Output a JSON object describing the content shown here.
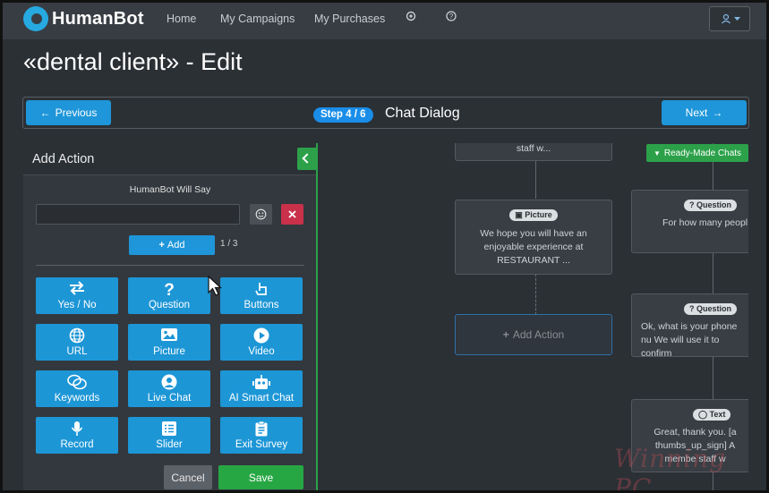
{
  "navbar": {
    "logo_text": "HumanBot",
    "links": [
      "Home",
      "My Campaigns",
      "My Purchases"
    ],
    "icon_1": "settings-icon",
    "icon_2": "help-icon",
    "user_icon": "user-icon",
    "brand_color": "#26a9e0"
  },
  "page": {
    "title": "«dental client» - Edit"
  },
  "stepbar": {
    "previous_label": "Previous",
    "next_label": "Next",
    "step_badge": "Step 4 / 6",
    "step_title": "Chat Dialog"
  },
  "panel": {
    "title": "Add Action",
    "says_label": "HumanBot Will Say",
    "say_input_value": "",
    "add_label": "Add",
    "counter": "1 / 3",
    "actions": [
      {
        "label": "Yes / No",
        "icon": "swap-icon"
      },
      {
        "label": "Question",
        "icon": "question-icon"
      },
      {
        "label": "Buttons",
        "icon": "pointer-hand-icon"
      },
      {
        "label": "URL",
        "icon": "globe-icon"
      },
      {
        "label": "Picture",
        "icon": "image-icon"
      },
      {
        "label": "Video",
        "icon": "play-icon"
      },
      {
        "label": "Keywords",
        "icon": "chat-bubbles-icon"
      },
      {
        "label": "Live Chat",
        "icon": "user-circle-icon"
      },
      {
        "label": "AI Smart Chat",
        "icon": "robot-icon"
      },
      {
        "label": "Record",
        "icon": "microphone-icon"
      },
      {
        "label": "Slider",
        "icon": "list-icon"
      },
      {
        "label": "Exit Survey",
        "icon": "clipboard-icon"
      }
    ],
    "cancel_label": "Cancel",
    "save_label": "Save"
  },
  "canvas": {
    "ready_made_label": "Ready-Made Chats",
    "nodes": {
      "top_text": "staff w...",
      "picture_badge": "Picture",
      "picture_text": "We hope you will have an enjoyable experience at RESTAURANT ...",
      "add_action_label": "Add Action",
      "question1_badge": "Question",
      "question1_text": "For how many peopl",
      "question2_badge": "Question",
      "question2_text": "Ok, what is your phone nu We will use it to confirm",
      "text_badge": "Text",
      "text_text": "Great, thank you. [a thumbs_up_sign] A membe staff w"
    }
  },
  "watermark": "Winning PC",
  "colors": {
    "accent_blue": "#1e96d9",
    "save_green": "#27a744",
    "danger_red": "#c9304a",
    "background": "#2b3035"
  }
}
